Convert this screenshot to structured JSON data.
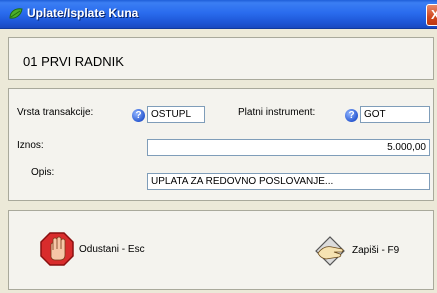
{
  "window": {
    "title": "Uplate/Isplate Kuna",
    "close_glyph": "X"
  },
  "header": {
    "employee": "01  PRVI RADNIK"
  },
  "form": {
    "transaction_type": {
      "label": "Vrsta transakcije:",
      "value": "OSTUPL"
    },
    "payment_instrument": {
      "label": "Platni instrument:",
      "value": "GOT"
    },
    "amount": {
      "label": "Iznos:",
      "value": "5.000,00"
    },
    "description": {
      "label": "Opis:",
      "value": "UPLATA ZA REDOVNO POSLOVANJE..."
    },
    "lookup_icon": "?"
  },
  "buttons": {
    "cancel": {
      "label": "Odustani - Esc",
      "icon": "stop-hand-icon"
    },
    "save": {
      "label": "Zapiši - F9",
      "icon": "save-hand-icon"
    }
  },
  "colors": {
    "titlebar": "#2a6cee",
    "panel": "#f4f3ee",
    "window": "#ece9d8",
    "stop": "#d92c2c"
  }
}
